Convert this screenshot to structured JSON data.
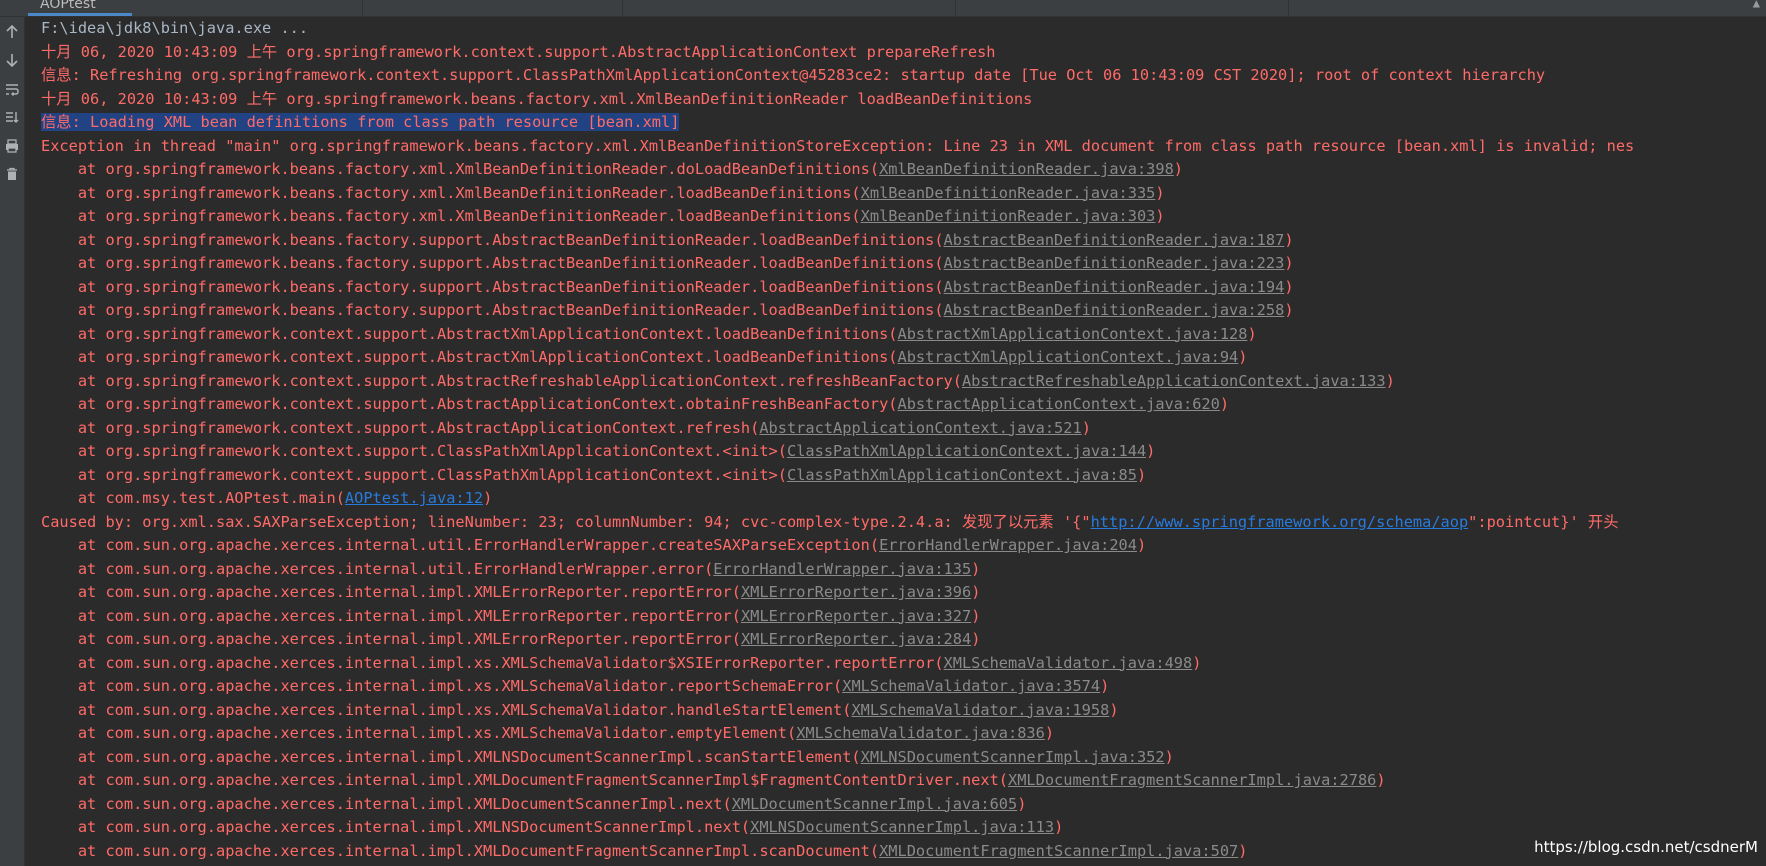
{
  "tab": {
    "title": "AOPtest"
  },
  "lines": [
    {
      "type": "cmd",
      "text": "F:\\idea\\jdk8\\bin\\java.exe ..."
    },
    {
      "type": "err",
      "text": "十月 06, 2020 10:43:09 上午 org.springframework.context.support.AbstractApplicationContext prepareRefresh"
    },
    {
      "type": "err",
      "text": "信息: Refreshing org.springframework.context.support.ClassPathXmlApplicationContext@45283ce2: startup date [Tue Oct 06 10:43:09 CST 2020]; root of context hierarchy"
    },
    {
      "type": "err",
      "text": "十月 06, 2020 10:43:09 上午 org.springframework.beans.factory.xml.XmlBeanDefinitionReader loadBeanDefinitions"
    },
    {
      "type": "sel",
      "text": "信息: Loading XML bean definitions from class path resource [bean.xml]"
    },
    {
      "type": "err",
      "text": "Exception in thread \"main\" org.springframework.beans.factory.xml.XmlBeanDefinitionStoreException: Line 23 in XML document from class path resource [bean.xml] is invalid; nes"
    },
    {
      "type": "frame",
      "pre": "    at org.springframework.beans.factory.xml.XmlBeanDefinitionReader.doLoadBeanDefinitions(",
      "link": "XmlBeanDefinitionReader.java:398",
      "post": ")"
    },
    {
      "type": "frame",
      "pre": "    at org.springframework.beans.factory.xml.XmlBeanDefinitionReader.loadBeanDefinitions(",
      "link": "XmlBeanDefinitionReader.java:335",
      "post": ")"
    },
    {
      "type": "frame",
      "pre": "    at org.springframework.beans.factory.xml.XmlBeanDefinitionReader.loadBeanDefinitions(",
      "link": "XmlBeanDefinitionReader.java:303",
      "post": ")"
    },
    {
      "type": "frame",
      "pre": "    at org.springframework.beans.factory.support.AbstractBeanDefinitionReader.loadBeanDefinitions(",
      "link": "AbstractBeanDefinitionReader.java:187",
      "post": ")"
    },
    {
      "type": "frame",
      "pre": "    at org.springframework.beans.factory.support.AbstractBeanDefinitionReader.loadBeanDefinitions(",
      "link": "AbstractBeanDefinitionReader.java:223",
      "post": ")"
    },
    {
      "type": "frame",
      "pre": "    at org.springframework.beans.factory.support.AbstractBeanDefinitionReader.loadBeanDefinitions(",
      "link": "AbstractBeanDefinitionReader.java:194",
      "post": ")"
    },
    {
      "type": "frame",
      "pre": "    at org.springframework.beans.factory.support.AbstractBeanDefinitionReader.loadBeanDefinitions(",
      "link": "AbstractBeanDefinitionReader.java:258",
      "post": ")"
    },
    {
      "type": "frame",
      "pre": "    at org.springframework.context.support.AbstractXmlApplicationContext.loadBeanDefinitions(",
      "link": "AbstractXmlApplicationContext.java:128",
      "post": ")"
    },
    {
      "type": "frame",
      "pre": "    at org.springframework.context.support.AbstractXmlApplicationContext.loadBeanDefinitions(",
      "link": "AbstractXmlApplicationContext.java:94",
      "post": ")"
    },
    {
      "type": "frame",
      "pre": "    at org.springframework.context.support.AbstractRefreshableApplicationContext.refreshBeanFactory(",
      "link": "AbstractRefreshableApplicationContext.java:133",
      "post": ")"
    },
    {
      "type": "frame",
      "pre": "    at org.springframework.context.support.AbstractApplicationContext.obtainFreshBeanFactory(",
      "link": "AbstractApplicationContext.java:620",
      "post": ")"
    },
    {
      "type": "frame",
      "pre": "    at org.springframework.context.support.AbstractApplicationContext.refresh(",
      "link": "AbstractApplicationContext.java:521",
      "post": ")"
    },
    {
      "type": "frame",
      "pre": "    at org.springframework.context.support.ClassPathXmlApplicationContext.<init>(",
      "link": "ClassPathXmlApplicationContext.java:144",
      "post": ")"
    },
    {
      "type": "frame",
      "pre": "    at org.springframework.context.support.ClassPathXmlApplicationContext.<init>(",
      "link": "ClassPathXmlApplicationContext.java:85",
      "post": ")"
    },
    {
      "type": "frame",
      "pre": "    at com.msy.test.AOPtest.main(",
      "link": "AOPtest.java:12",
      "post": ")",
      "linkStyle": "url"
    },
    {
      "type": "frame",
      "pre": "Caused by: org.xml.sax.SAXParseException; lineNumber: 23; columnNumber: 94; cvc-complex-type.2.4.a: 发现了以元素 '{\"",
      "link": "http://www.springframework.org/schema/aop",
      "post": "\":pointcut}' 开头",
      "linkStyle": "url"
    },
    {
      "type": "frame",
      "pre": "    at com.sun.org.apache.xerces.internal.util.ErrorHandlerWrapper.createSAXParseException(",
      "link": "ErrorHandlerWrapper.java:204",
      "post": ")"
    },
    {
      "type": "frame",
      "pre": "    at com.sun.org.apache.xerces.internal.util.ErrorHandlerWrapper.error(",
      "link": "ErrorHandlerWrapper.java:135",
      "post": ")"
    },
    {
      "type": "frame",
      "pre": "    at com.sun.org.apache.xerces.internal.impl.XMLErrorReporter.reportError(",
      "link": "XMLErrorReporter.java:396",
      "post": ")"
    },
    {
      "type": "frame",
      "pre": "    at com.sun.org.apache.xerces.internal.impl.XMLErrorReporter.reportError(",
      "link": "XMLErrorReporter.java:327",
      "post": ")"
    },
    {
      "type": "frame",
      "pre": "    at com.sun.org.apache.xerces.internal.impl.XMLErrorReporter.reportError(",
      "link": "XMLErrorReporter.java:284",
      "post": ")"
    },
    {
      "type": "frame",
      "pre": "    at com.sun.org.apache.xerces.internal.impl.xs.XMLSchemaValidator$XSIErrorReporter.reportError(",
      "link": "XMLSchemaValidator.java:498",
      "post": ")"
    },
    {
      "type": "frame",
      "pre": "    at com.sun.org.apache.xerces.internal.impl.xs.XMLSchemaValidator.reportSchemaError(",
      "link": "XMLSchemaValidator.java:3574",
      "post": ")"
    },
    {
      "type": "frame",
      "pre": "    at com.sun.org.apache.xerces.internal.impl.xs.XMLSchemaValidator.handleStartElement(",
      "link": "XMLSchemaValidator.java:1958",
      "post": ")"
    },
    {
      "type": "frame",
      "pre": "    at com.sun.org.apache.xerces.internal.impl.xs.XMLSchemaValidator.emptyElement(",
      "link": "XMLSchemaValidator.java:836",
      "post": ")"
    },
    {
      "type": "frame",
      "pre": "    at com.sun.org.apache.xerces.internal.impl.XMLNSDocumentScannerImpl.scanStartElement(",
      "link": "XMLNSDocumentScannerImpl.java:352",
      "post": ")"
    },
    {
      "type": "frame",
      "pre": "    at com.sun.org.apache.xerces.internal.impl.XMLDocumentFragmentScannerImpl$FragmentContentDriver.next(",
      "link": "XMLDocumentFragmentScannerImpl.java:2786",
      "post": ")"
    },
    {
      "type": "frame",
      "pre": "    at com.sun.org.apache.xerces.internal.impl.XMLDocumentScannerImpl.next(",
      "link": "XMLDocumentScannerImpl.java:605",
      "post": ")"
    },
    {
      "type": "frame",
      "pre": "    at com.sun.org.apache.xerces.internal.impl.XMLNSDocumentScannerImpl.next(",
      "link": "XMLNSDocumentScannerImpl.java:113",
      "post": ")"
    },
    {
      "type": "frame",
      "pre": "    at com.sun.org.apache.xerces.internal.impl.XMLDocumentFragmentScannerImpl.scanDocument(",
      "link": "XMLDocumentFragmentScannerImpl.java:507",
      "post": ")"
    }
  ],
  "toolbar": {
    "icons": [
      "up-arrow-icon",
      "down-arrow-icon",
      "soft-wrap-icon",
      "scroll-to-end-icon",
      "print-icon",
      "trash-icon"
    ]
  },
  "watermark": "https://blog.csdn.net/csdnerM",
  "colors": {
    "error": "#ff6b68",
    "normal": "#a9b7c6",
    "link": "#8a8a8a",
    "url": "#287bde",
    "selection": "#214283",
    "background": "#2b2b2b"
  }
}
